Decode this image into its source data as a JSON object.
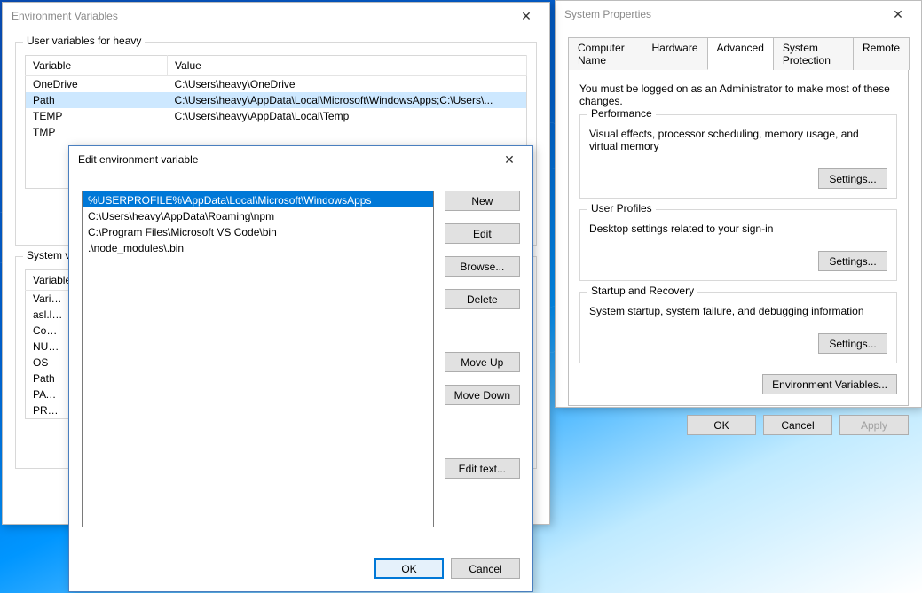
{
  "envvar_window": {
    "title": "Environment Variables",
    "user_section_label": "User variables for heavy",
    "sys_section_label": "System v",
    "headers": {
      "name": "Variable",
      "value": "Value"
    },
    "user_vars": [
      {
        "name": "OneDrive",
        "value": "C:\\Users\\heavy\\OneDrive"
      },
      {
        "name": "Path",
        "value": "C:\\Users\\heavy\\AppData\\Local\\Microsoft\\WindowsApps;C:\\Users\\...",
        "selected": true
      },
      {
        "name": "TEMP",
        "value": "C:\\Users\\heavy\\AppData\\Local\\Temp"
      },
      {
        "name": "TMP",
        "value": ""
      }
    ],
    "sys_vars_visible": [
      {
        "name": "Variabl"
      },
      {
        "name": "asl.log"
      },
      {
        "name": "ComSp"
      },
      {
        "name": "NUMB"
      },
      {
        "name": "OS"
      },
      {
        "name": "Path"
      },
      {
        "name": "PATHE"
      },
      {
        "name": "PROCE"
      }
    ]
  },
  "edit_window": {
    "title": "Edit environment variable",
    "entries": [
      {
        "value": "%USERPROFILE%\\AppData\\Local\\Microsoft\\WindowsApps",
        "selected": true
      },
      {
        "value": "C:\\Users\\heavy\\AppData\\Roaming\\npm"
      },
      {
        "value": "C:\\Program Files\\Microsoft VS Code\\bin"
      },
      {
        "value": ".\\node_modules\\.bin"
      }
    ],
    "buttons": {
      "new": "New",
      "edit": "Edit",
      "browse": "Browse...",
      "delete": "Delete",
      "moveup": "Move Up",
      "movedown": "Move Down",
      "edittext": "Edit text...",
      "ok": "OK",
      "cancel": "Cancel"
    }
  },
  "sysprops_window": {
    "title": "System Properties",
    "tabs": [
      {
        "label": "Computer Name"
      },
      {
        "label": "Hardware"
      },
      {
        "label": "Advanced",
        "active": true
      },
      {
        "label": "System Protection"
      },
      {
        "label": "Remote"
      }
    ],
    "admin_note": "You must be logged on as an Administrator to make most of these changes.",
    "performance": {
      "title": "Performance",
      "desc": "Visual effects, processor scheduling, memory usage, and virtual memory"
    },
    "userprofiles": {
      "title": "User Profiles",
      "desc": "Desktop settings related to your sign-in"
    },
    "startup": {
      "title": "Startup and Recovery",
      "desc": "System startup, system failure, and debugging information"
    },
    "settings_label": "Settings...",
    "envvar_label": "Environment Variables...",
    "ok": "OK",
    "cancel": "Cancel",
    "apply": "Apply"
  }
}
